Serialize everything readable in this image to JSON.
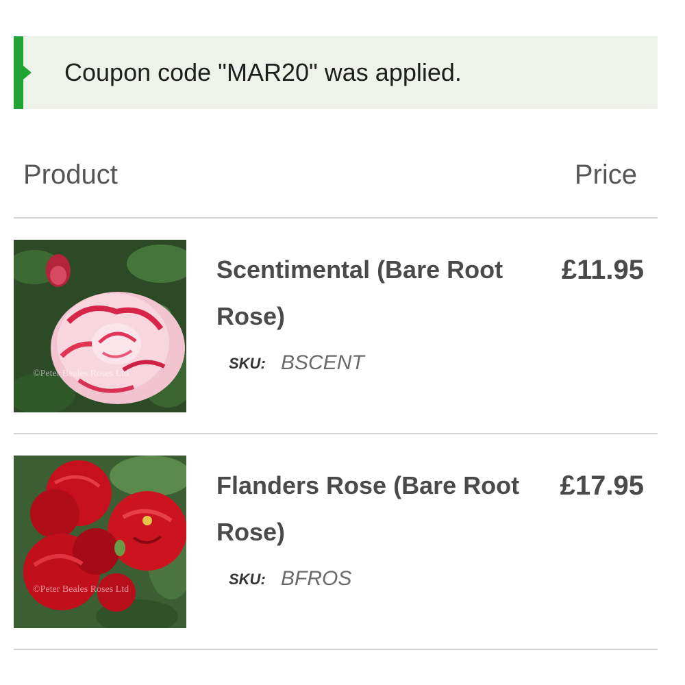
{
  "notice": {
    "message": "Coupon code \"MAR20\" was applied.",
    "accent_color": "#1fa333",
    "background_color": "#edf2ea"
  },
  "table": {
    "headers": {
      "product": "Product",
      "price": "Price"
    },
    "sku_label": "SKU:",
    "items": [
      {
        "name": "Scentimental (Bare Root Rose)",
        "sku": "BSCENT",
        "price": "£11.95",
        "image": "rose-pink-white-striped",
        "watermark": "©Peter Beales Roses Ltd"
      },
      {
        "name": "Flanders Rose (Bare Root Rose)",
        "sku": "BFROS",
        "price": "£17.95",
        "image": "rose-red-cluster",
        "watermark": "©Peter Beales Roses Ltd"
      }
    ]
  }
}
